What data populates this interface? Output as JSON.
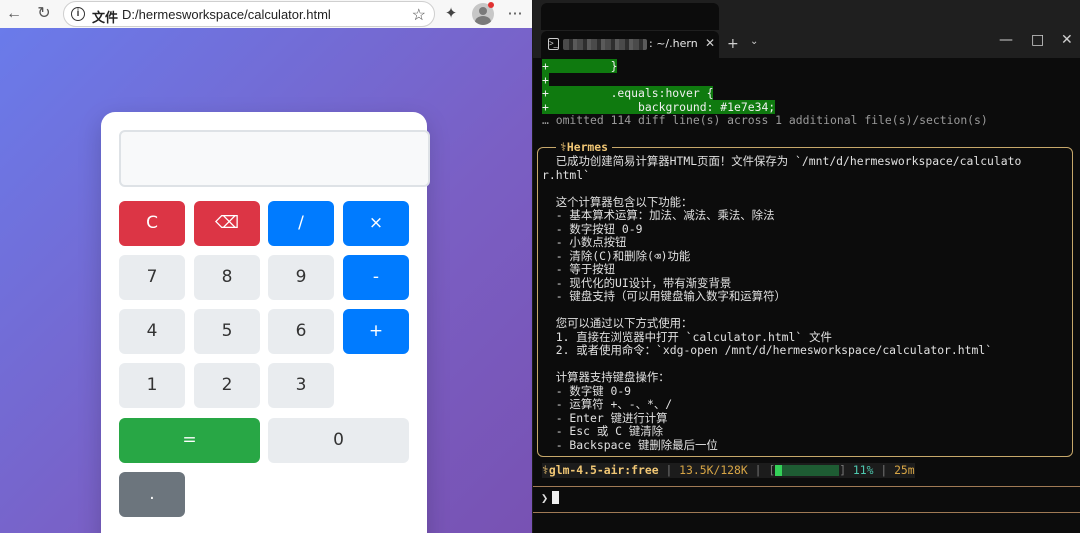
{
  "browser": {
    "omnibox": {
      "scheme_label": "文件",
      "url": "D:/hermesworkspace/calculator.html"
    },
    "calculator": {
      "display_value": "",
      "keys": [
        "C",
        "⌫",
        "/",
        "×",
        "7",
        "8",
        "9",
        "-",
        "4",
        "5",
        "6",
        "+",
        "1",
        "2",
        "3",
        "=",
        "0",
        "."
      ]
    }
  },
  "terminal": {
    "tab_title": ": ~/.hern",
    "diff_lines": [
      "+         }",
      "+",
      "+         .equals:hover {",
      "+             background: #1e7e34;"
    ],
    "omitted": "… omitted 114 diff line(s) across 1 additional file(s)/section(s)",
    "box_title": "⚕Hermes",
    "response_lines": [
      "  已成功创建简易计算器HTML页面！文件保存为 `/mnt/d/hermesworkspace/calculato",
      "r.html`",
      "",
      "  这个计算器包含以下功能：",
      "  - 基本算术运算：加法、减法、乘法、除法",
      "  - 数字按钮 0-9",
      "  - 小数点按钮",
      "  - 清除(C)和删除(⌫)功能",
      "  - 等于按钮",
      "  - 现代化的UI设计，带有渐变背景",
      "  - 键盘支持（可以用键盘输入数字和运算符）",
      "",
      "  您可以通过以下方式使用：",
      "  1. 直接在浏览器中打开 `calculator.html` 文件",
      "  2. 或者使用命令：`xdg-open /mnt/d/hermesworkspace/calculator.html`",
      "",
      "  计算器支持键盘操作：",
      "  - 数字键 0-9",
      "  - 运算符 +、-、*、/",
      "  - Enter 键进行计算",
      "  - Esc 或 C 键清除",
      "  - Backspace 键删除最后一位"
    ],
    "status": {
      "model": "⚕glm-4.5-air:free",
      "tokens": "13.5K/128K",
      "context_fraction": 0.11,
      "percent": "11%",
      "elapsed": "25m"
    },
    "prompt": "❯"
  }
}
